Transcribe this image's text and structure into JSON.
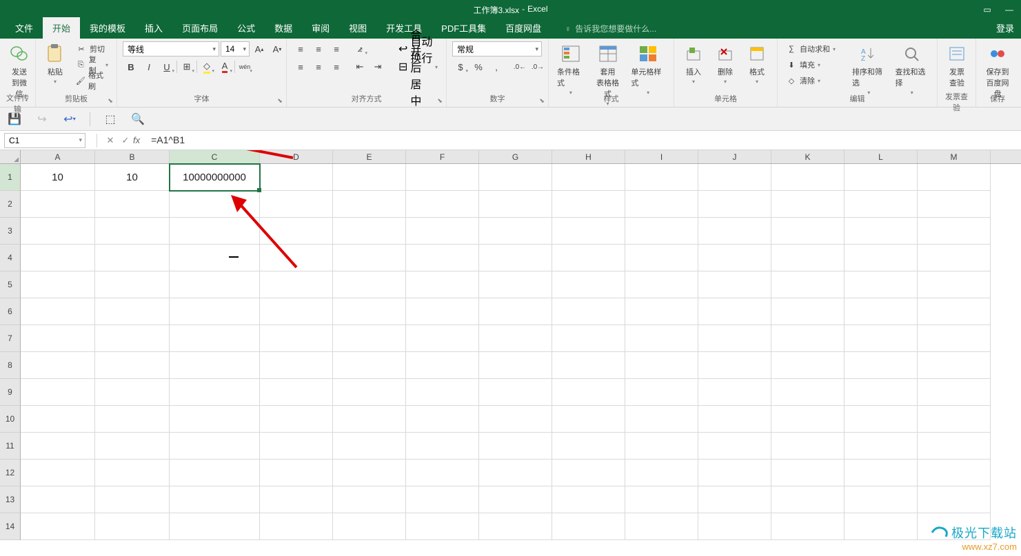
{
  "title": {
    "doc": "工作簿3.xlsx",
    "app": "Excel"
  },
  "tabs": [
    "文件",
    "开始",
    "我的模板",
    "插入",
    "页面布局",
    "公式",
    "数据",
    "审阅",
    "视图",
    "开发工具",
    "PDF工具集",
    "百度网盘"
  ],
  "tell_me": "告诉我您想要做什么...",
  "login": "登录",
  "ribbon": {
    "send_wechat": "发送\n到微信",
    "paste": "粘贴",
    "cut": "剪切",
    "copy": "复制",
    "format_painter": "格式刷",
    "clipboard": "剪贴板",
    "file_transfer": "文件传输",
    "font_name": "等线",
    "font_size": "14",
    "font_group": "字体",
    "wrap": "自动换行",
    "merge": "合并后居中",
    "align": "对齐方式",
    "number_format": "常规",
    "number": "数字",
    "cond_fmt": "条件格式",
    "table_fmt": "套用\n表格格式",
    "cell_styles": "单元格样式",
    "styles": "样式",
    "insert": "插入",
    "delete": "删除",
    "format": "格式",
    "cells": "单元格",
    "autosum": "自动求和",
    "fill": "填充",
    "clear": "清除",
    "sort_filter": "排序和筛选",
    "find_select": "查找和选择",
    "editing": "编辑",
    "invoice": "发票\n查验",
    "invoice_group": "发票查验",
    "save_baidu": "保存到\n百度网盘",
    "save_group": "保存"
  },
  "name_box": "C1",
  "formula": "=A1^B1",
  "columns": [
    "A",
    "B",
    "C",
    "D",
    "E",
    "F",
    "G",
    "H",
    "I",
    "J",
    "K",
    "L",
    "M"
  ],
  "rows": [
    1,
    2,
    3,
    4,
    5,
    6,
    7,
    8,
    9,
    10,
    11,
    12,
    13,
    14
  ],
  "cells": {
    "A1": "10",
    "B1": "10",
    "C1": "10000000000"
  },
  "selected": "C1",
  "watermark": {
    "top": "极光下载站",
    "bot": "www.xz7.com"
  }
}
